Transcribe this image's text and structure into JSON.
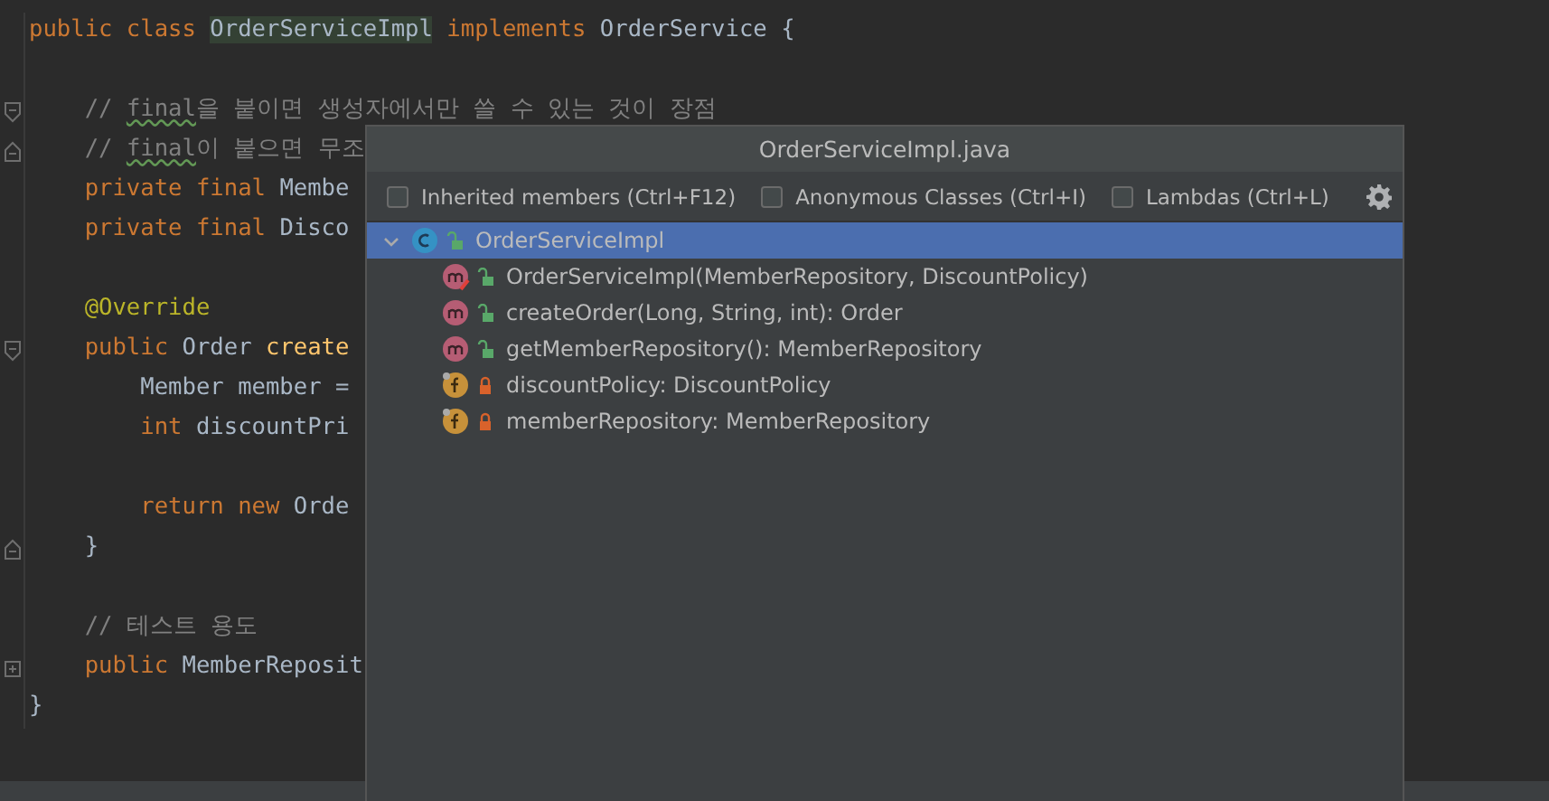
{
  "editor": {
    "lines": [
      {
        "kind": "plain",
        "tokens": [
          {
            "kind": "keyword",
            "text": "public class "
          },
          {
            "kind": "highlight",
            "text": "OrderServiceImpl"
          },
          {
            "kind": "keyword",
            "text": " implements "
          },
          {
            "kind": "plain",
            "text": "OrderService {"
          }
        ]
      },
      {
        "kind": "plain"
      },
      {
        "kind": "foldstart",
        "tokens": [
          {
            "kind": "comment",
            "text": "    // "
          },
          {
            "kind": "typo",
            "text": "final"
          },
          {
            "kind": "comment",
            "text": "을 붙이면 생성자에서만 쓸 수 있는 것이 장점"
          }
        ]
      },
      {
        "kind": "foldend",
        "tokens": [
          {
            "kind": "comment",
            "text": "    // "
          },
          {
            "kind": "typo",
            "text": "final"
          },
          {
            "kind": "comment",
            "text": "이 붙으면 무조"
          }
        ]
      },
      {
        "kind": "plain",
        "tokens": [
          {
            "kind": "keyword",
            "text": "    private final "
          },
          {
            "kind": "plain",
            "text": "Membe"
          }
        ]
      },
      {
        "kind": "plain",
        "tokens": [
          {
            "kind": "keyword",
            "text": "    private final "
          },
          {
            "kind": "plain",
            "text": "Disco"
          }
        ]
      },
      {
        "kind": "plain"
      },
      {
        "kind": "plain",
        "tokens": [
          {
            "kind": "annotation",
            "text": "    @Override"
          }
        ]
      },
      {
        "kind": "foldstart",
        "tokens": [
          {
            "kind": "keyword",
            "text": "    public "
          },
          {
            "kind": "plain",
            "text": "Order "
          },
          {
            "kind": "method",
            "text": "create"
          }
        ]
      },
      {
        "kind": "plain",
        "tokens": [
          {
            "kind": "plain",
            "text": "        Member member ="
          }
        ]
      },
      {
        "kind": "plain",
        "tokens": [
          {
            "kind": "keyword",
            "text": "        int "
          },
          {
            "kind": "plain",
            "text": "discountPri"
          }
        ]
      },
      {
        "kind": "plain"
      },
      {
        "kind": "plain",
        "tokens": [
          {
            "kind": "keyword",
            "text": "        return new "
          },
          {
            "kind": "plain",
            "text": "Orde"
          }
        ]
      },
      {
        "kind": "foldend",
        "tokens": [
          {
            "kind": "plain",
            "text": "    }"
          }
        ]
      },
      {
        "kind": "plain"
      },
      {
        "kind": "plain",
        "tokens": [
          {
            "kind": "comment",
            "text": "    // 테스트 용도"
          }
        ]
      },
      {
        "kind": "collapsed",
        "tokens": [
          {
            "kind": "keyword",
            "text": "    public "
          },
          {
            "kind": "plain",
            "text": "MemberReposit"
          }
        ]
      },
      {
        "kind": "plain",
        "tokens": [
          {
            "kind": "plain",
            "text": "}"
          }
        ]
      }
    ]
  },
  "popup": {
    "title": "OrderServiceImpl.java",
    "filters": [
      {
        "label": "Inherited members (Ctrl+F12)",
        "checked": false
      },
      {
        "label": "Anonymous Classes (Ctrl+I)",
        "checked": false
      },
      {
        "label": "Lambdas (Ctrl+L)",
        "checked": false
      }
    ],
    "tree": [
      {
        "label": "OrderServiceImpl",
        "kind": "class",
        "private": false,
        "expanded": true,
        "selected": true,
        "children": [
          {
            "label": "OrderServiceImpl(MemberRepository, DiscountPolicy)",
            "kind": "constructor",
            "private": false,
            "selected": false
          },
          {
            "label": "createOrder(Long, String, int): Order",
            "kind": "method",
            "private": false,
            "selected": false
          },
          {
            "label": "getMemberRepository(): MemberRepository",
            "kind": "method",
            "private": false,
            "selected": false
          },
          {
            "label": "discountPolicy: DiscountPolicy",
            "kind": "field",
            "private": true,
            "selected": false
          },
          {
            "label": "memberRepository: MemberRepository",
            "kind": "field",
            "private": true,
            "selected": false
          }
        ]
      }
    ]
  }
}
